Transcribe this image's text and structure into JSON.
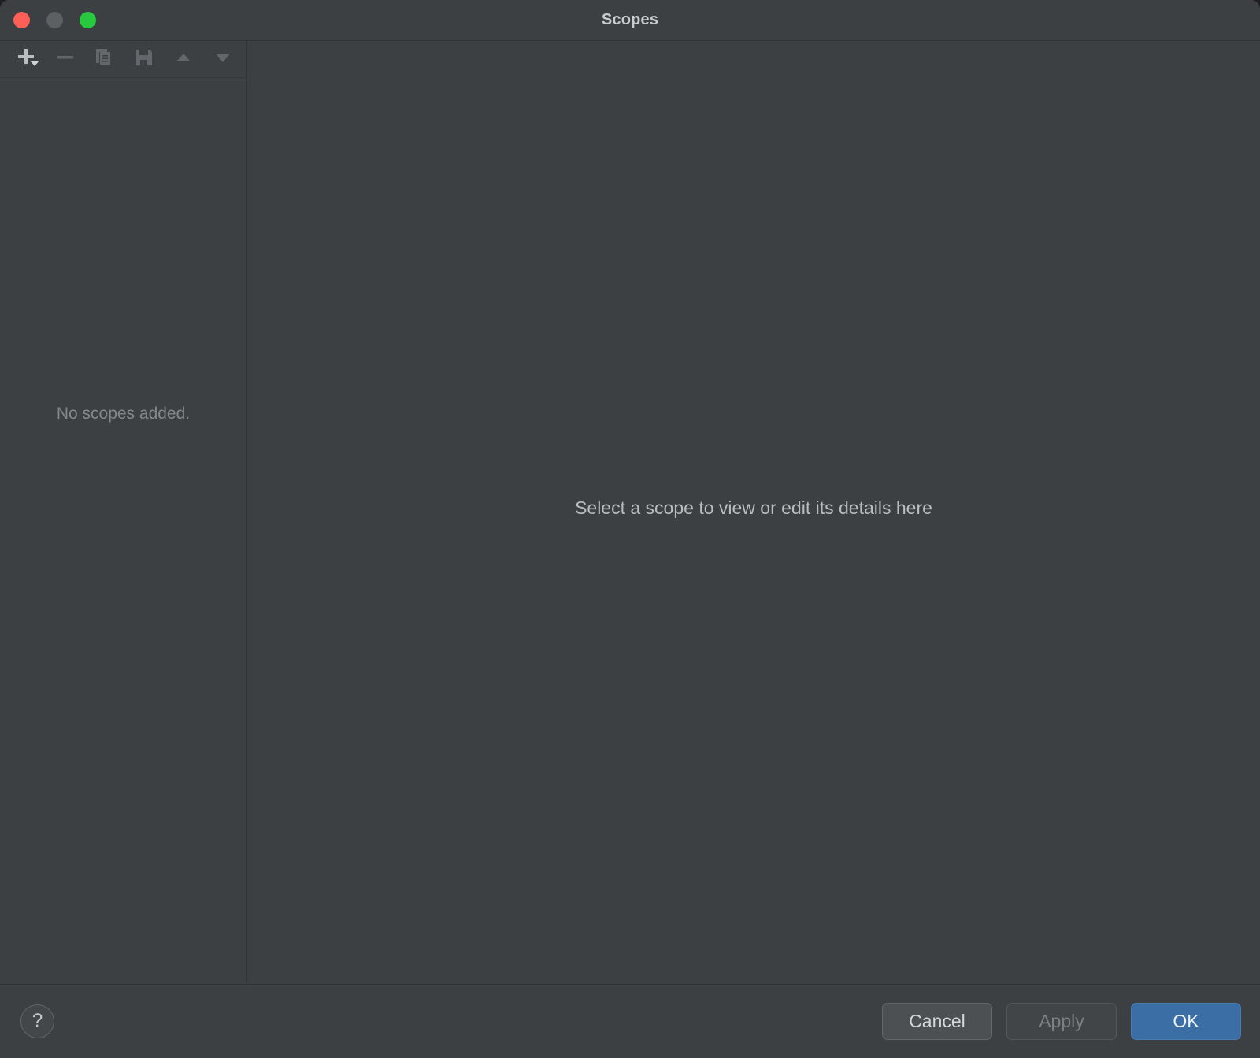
{
  "window": {
    "title": "Scopes",
    "traffic_lights": [
      {
        "name": "close",
        "color": "#fe5f57"
      },
      {
        "name": "minimize",
        "color": "#5c6063"
      },
      {
        "name": "zoom",
        "color": "#27c93f"
      }
    ]
  },
  "toolbar": {
    "buttons": [
      {
        "icon": "add-icon",
        "label": "Add scope",
        "enabled": true
      },
      {
        "icon": "remove-icon",
        "label": "Remove scope",
        "enabled": false
      },
      {
        "icon": "copy-icon",
        "label": "Duplicate scope",
        "enabled": false
      },
      {
        "icon": "save-icon",
        "label": "Save scope",
        "enabled": false
      },
      {
        "icon": "move-up-icon",
        "label": "Move up",
        "enabled": false
      },
      {
        "icon": "move-down-icon",
        "label": "Move down",
        "enabled": false
      }
    ]
  },
  "left_panel": {
    "empty_message": "No scopes added."
  },
  "right_panel": {
    "empty_message": "Select a scope to view or edit its details here"
  },
  "footer": {
    "help_label": "?",
    "cancel_label": "Cancel",
    "apply_label": "Apply",
    "ok_label": "OK"
  },
  "colors": {
    "background": "#3c4043",
    "divider": "#303336",
    "primary_button": "#3b6ea5",
    "text_muted": "#83888b",
    "text_normal": "#c9ccce"
  }
}
